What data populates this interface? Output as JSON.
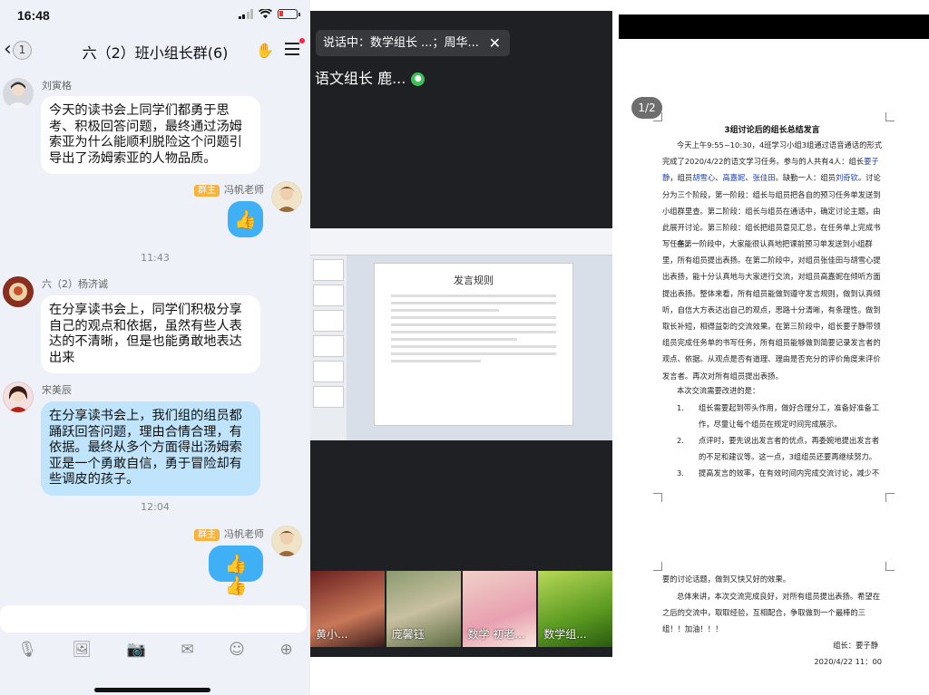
{
  "status_bar": {
    "time": "16:48"
  },
  "chat_header": {
    "back_count": "1",
    "title": "六（2）班小组长群(6)"
  },
  "messages": [
    {
      "sender": "刘寅格",
      "text": "今天的读书会上同学们都勇于思考、积极回答问题，最终通过汤姆索亚为什么能顺利脱险这个问题引导出了汤姆索亚的人物品质。"
    },
    {
      "sender": "冯帆老师",
      "role": "群主",
      "text": "👍"
    },
    {
      "timestamp": "11:43"
    },
    {
      "sender": "六（2）杨济诚",
      "text": "在分享读书会上，同学们积极分享自己的观点和依据，虽然有些人表达的不清晰，但是也能勇敢地表达出来"
    },
    {
      "sender": "宋美辰",
      "text": "在分享读书会上，我们组的组员都踊跃回答问题，理由合情合理，有依据。最终从多个方面得出汤姆索亚是一个勇敢自信，勇于冒险却有些调皮的孩子。"
    },
    {
      "timestamp": "12:04"
    },
    {
      "sender": "冯帆老师",
      "role": "群主",
      "text": "👍👍"
    }
  ],
  "toolbar_icons": [
    "microphone-icon",
    "image-icon",
    "camera-icon",
    "red-packet-icon",
    "emoji-icon",
    "plus-icon"
  ],
  "meeting": {
    "speaking_label": "说话中：数学组长 ...；周华...",
    "active_speaker": "语文组长 鹿...",
    "slide_title": "发言规则",
    "participants": [
      "黄小...",
      "庞馨钰",
      "数学 初老...",
      "数学组..."
    ]
  },
  "document": {
    "page_indicator": "1/2",
    "title": "3组讨论后的组长总结发言",
    "para1_a": "今天上午9:55~10:30，4班学习小组3组通过语音通话的形式完成了2020/4/22的语文学习任务。参与的人共有4人：组长",
    "para1_n1": "要子静",
    "para1_b": "，组员",
    "para1_n2": "胡雪心",
    "para1_sep1": "、",
    "para1_n3": "高嘉妮",
    "para1_sep2": "、",
    "para1_n4": "张佳田",
    "para1_c": "。缺勤一人：组员",
    "para1_n5": "刘奇钦",
    "para1_d": "。讨论分为三个阶段，第一阶段：组长与组员把各自的预习任务单发送到小组群里查。第二阶段：组长与组员在通话中，确定讨论主题，由此展开讨论。第三阶段：组长把组员意见汇总，在任务单上完成书写任务。",
    "para2": "在第一阶段中，大家能很认真地把课前预习单发送到小组群里，所有组员提出表扬。在第二阶段中，对组员张佳田与胡雪心提出表扬，能十分认真地与大家进行交流，对组员高嘉妮在倾听方面提出表扬。整体来看，所有组员能做到遵守发言规则，做到认真倾听，自信大方表达出自己的观点，思路十分清晰，有条理性。做到取长补短，相得益彰的交流效果。在第三阶段中，组长要子静带领组员完成任务单的书写任务，所有组员能够做到简要记录发言者的观点、依据。从观点是否有道理、理由是否充分的评价角度来评价发言者。再次对所有组员提出表扬。",
    "para3": "本次交流需要改进的是：",
    "list": [
      {
        "num": "1.",
        "text": "组长需要起到带头作用，做好合理分工，准备好准备工作，尽量让每个组员在规定时间完成展示。"
      },
      {
        "num": "2.",
        "text": "点评时，要先说出发言者的优点，再委婉地提出发言者的不足和建议等。这一点，3组组员还要再继续努力。"
      },
      {
        "num": "3.",
        "text": "提高发言的效率，在有效时间内完成交流讨论，减少不必"
      }
    ],
    "page2_a": "要的讨论话题，做到又快又好的效果。",
    "page2_b": "总体来讲，本次交流完成良好，对所有组员提出表扬。希望在之后的交流中，取取经验，互相配合，争取做到一个最棒的三组！！加油！！！",
    "signature": "组长：要子静",
    "date": "2020/4/22 11：00"
  }
}
